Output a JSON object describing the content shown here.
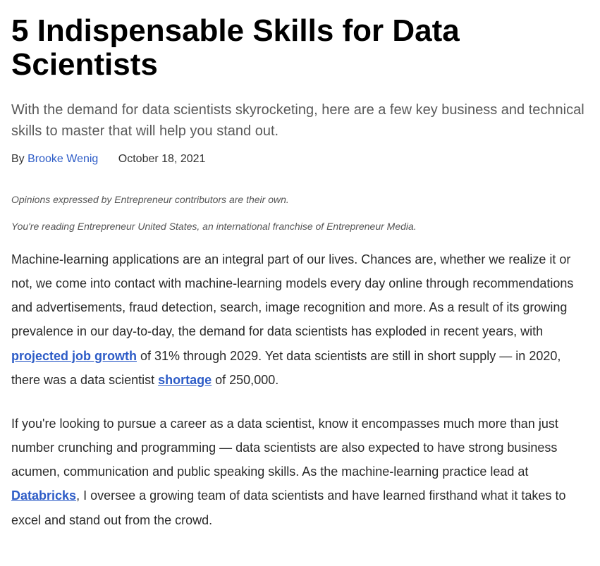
{
  "header": {
    "title": "5 Indispensable Skills for Data Scientists",
    "subtitle": "With the demand for data scientists skyrocketing, here are a few key business and technical skills to master that will help you stand out.",
    "by_label": "By ",
    "author": "Brooke Wenig",
    "date": "October 18, 2021"
  },
  "disclaimers": {
    "opinions": "Opinions expressed by Entrepreneur contributors are their own.",
    "franchise": "You're reading Entrepreneur United States, an international franchise of Entrepreneur Media."
  },
  "body": {
    "p1_part1": "Machine-learning applications are an integral part of our lives. Chances are, whether we realize it or not, we come into contact with machine-learning models every day online through recommendations and advertisements, fraud detection, search, image recognition and more. As a result of its growing prevalence in our day-to-day, the demand for data scientists has exploded in recent years, with ",
    "p1_link1": "projected job growth",
    "p1_part2": " of 31% through 2029. Yet data scientists are still in short supply — in 2020, there was a data scientist ",
    "p1_link2": "shortage",
    "p1_part3": " of 250,000.",
    "p2_part1": "If you're looking to pursue a career as a data scientist, know it encompasses much more than just number crunching and programming — data scientists are also expected to have strong business acumen, communication and public speaking skills. As the machine-learning practice lead at ",
    "p2_link1": "Databricks",
    "p2_part2": ", I oversee a growing team of data scientists and have learned firsthand what it takes to excel and stand out from the crowd."
  }
}
